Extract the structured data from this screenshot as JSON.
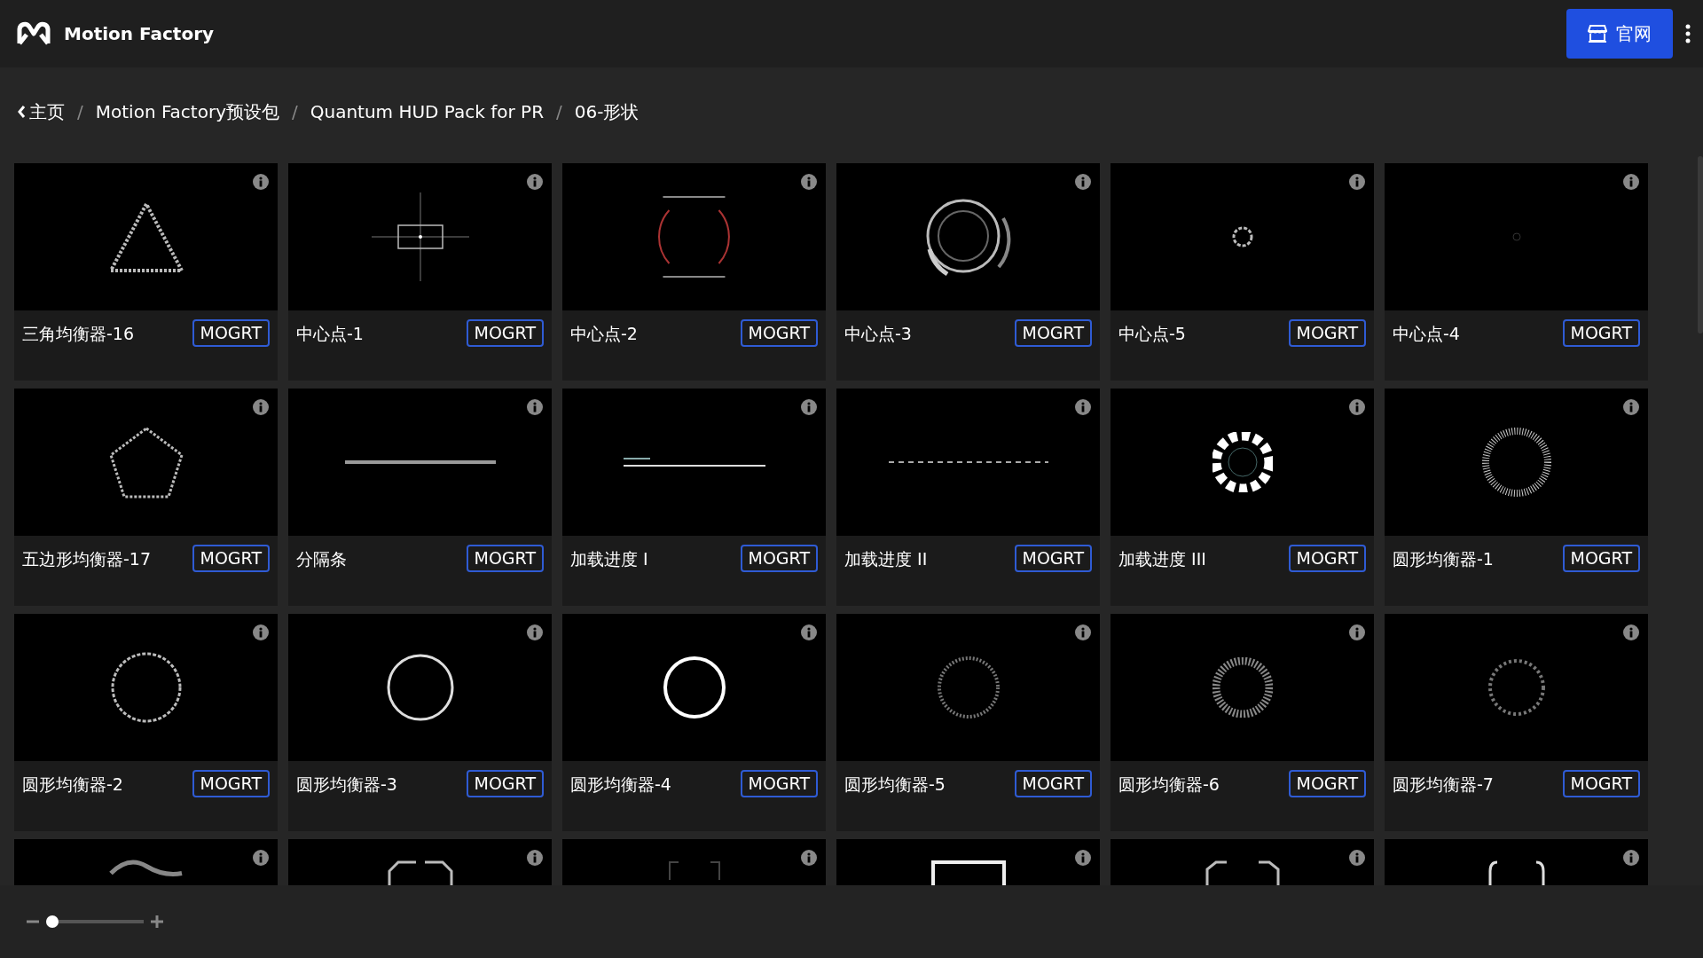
{
  "app": {
    "title": "Motion Factory",
    "website_button": "官网"
  },
  "breadcrumb": {
    "separator": "/",
    "items": [
      {
        "label": "主页",
        "kind": "back"
      },
      {
        "label": "Motion Factory预设包",
        "kind": "link"
      },
      {
        "label": "Quantum HUD Pack for PR",
        "kind": "link"
      },
      {
        "label": "06-形状",
        "kind": "current"
      }
    ]
  },
  "cards": [
    {
      "title": "三角均衡器-16",
      "badge": "MOGRT"
    },
    {
      "title": "中心点-1",
      "badge": "MOGRT"
    },
    {
      "title": "中心点-2",
      "badge": "MOGRT"
    },
    {
      "title": "中心点-3",
      "badge": "MOGRT"
    },
    {
      "title": "中心点-5",
      "badge": "MOGRT"
    },
    {
      "title": "中心点-4",
      "badge": "MOGRT"
    },
    {
      "title": "五边形均衡器-17",
      "badge": "MOGRT"
    },
    {
      "title": "分隔条",
      "badge": "MOGRT"
    },
    {
      "title": "加载进度 I",
      "badge": "MOGRT"
    },
    {
      "title": "加载进度 II",
      "badge": "MOGRT"
    },
    {
      "title": "加载进度 III",
      "badge": "MOGRT"
    },
    {
      "title": "圆形均衡器-1",
      "badge": "MOGRT"
    },
    {
      "title": "圆形均衡器-2",
      "badge": "MOGRT"
    },
    {
      "title": "圆形均衡器-3",
      "badge": "MOGRT"
    },
    {
      "title": "圆形均衡器-4",
      "badge": "MOGRT"
    },
    {
      "title": "圆形均衡器-5",
      "badge": "MOGRT"
    },
    {
      "title": "圆形均衡器-6",
      "badge": "MOGRT"
    },
    {
      "title": "圆形均衡器-7",
      "badge": "MOGRT"
    },
    {
      "cut_off": true
    },
    {
      "cut_off": true
    },
    {
      "cut_off": true
    },
    {
      "cut_off": true
    },
    {
      "cut_off": true
    },
    {
      "cut_off": true
    }
  ],
  "zoom": {
    "level": 0
  }
}
